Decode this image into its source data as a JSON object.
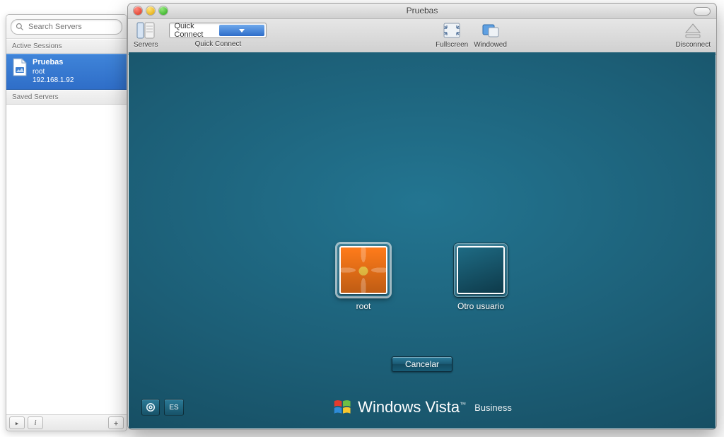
{
  "sidebar": {
    "search_placeholder": "Search Servers",
    "sections": {
      "active": "Active Sessions",
      "saved": "Saved Servers"
    },
    "active_session": {
      "name": "Pruebas",
      "user": "root",
      "host": "192.168.1.92"
    },
    "footer": {
      "play": "▸",
      "info": "i",
      "add": "+"
    }
  },
  "window": {
    "title": "Pruebas",
    "toolbar": {
      "servers": "Servers",
      "quick_connect_label": "Quick Connect",
      "quick_connect_value": "Quick Connect",
      "fullscreen": "Fullscreen",
      "windowed": "Windowed",
      "disconnect": "Disconnect"
    }
  },
  "vista": {
    "users": [
      {
        "name": "root"
      },
      {
        "name": "Otro usuario"
      }
    ],
    "cancel": "Cancelar",
    "lang_badge": "ES",
    "brand_prefix": "Windows",
    "brand_suffix": "Vista",
    "brand_tm": "™",
    "brand_edition": "Business"
  }
}
